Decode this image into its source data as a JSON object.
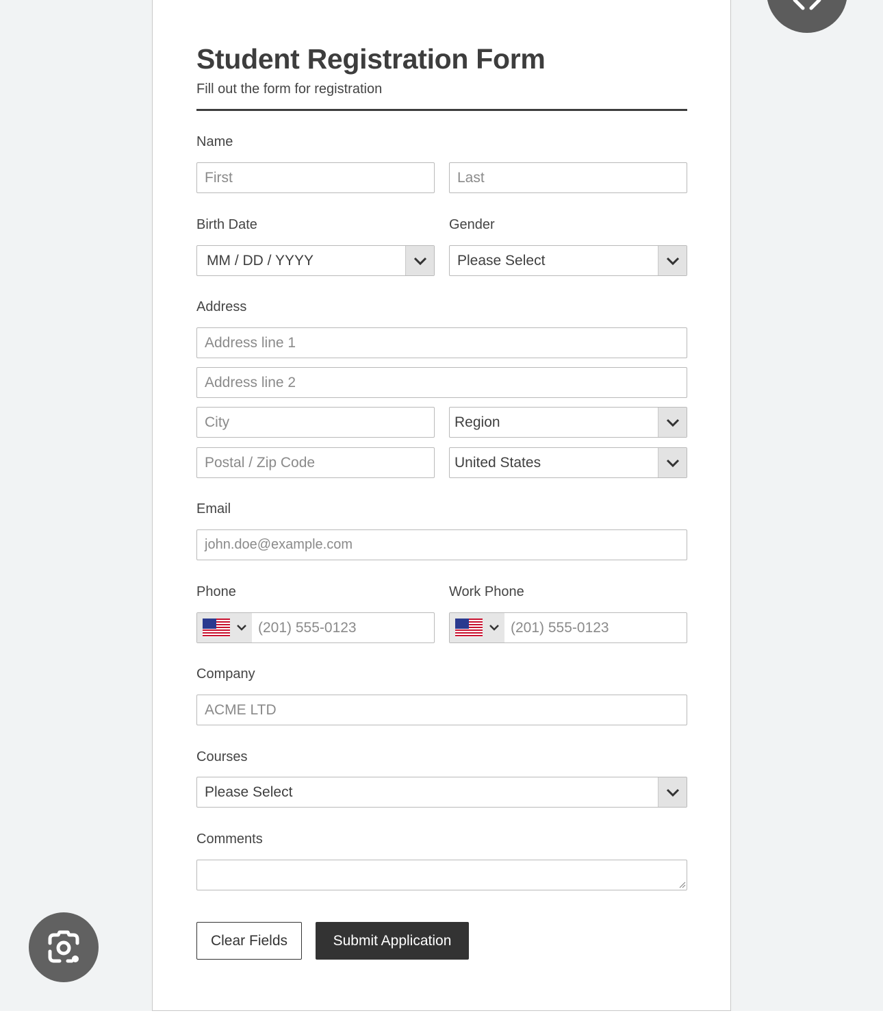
{
  "form": {
    "title": "Student Registration Form",
    "subtitle": "Fill out the form for registration",
    "name": {
      "label": "Name",
      "first_placeholder": "First",
      "last_placeholder": "Last"
    },
    "birth_date": {
      "label": "Birth Date",
      "placeholder": "MM / DD / YYYY"
    },
    "gender": {
      "label": "Gender",
      "value": "Please Select"
    },
    "address": {
      "label": "Address",
      "line1_placeholder": "Address line 1",
      "line2_placeholder": "Address line 2",
      "city_placeholder": "City",
      "region_value": "Region",
      "postal_placeholder": "Postal / Zip Code",
      "country_value": "United States"
    },
    "email": {
      "label": "Email",
      "placeholder": "john.doe@example.com"
    },
    "phone": {
      "label": "Phone",
      "placeholder": "(201) 555-0123",
      "country_flag": "us-flag-icon"
    },
    "work_phone": {
      "label": "Work Phone",
      "placeholder": "(201) 555-0123",
      "country_flag": "us-flag-icon"
    },
    "company": {
      "label": "Company",
      "placeholder": "ACME LTD"
    },
    "courses": {
      "label": "Courses",
      "value": "Please Select"
    },
    "comments": {
      "label": "Comments",
      "value": ""
    },
    "buttons": {
      "clear_label": "Clear Fields",
      "submit_label": "Submit Application"
    }
  },
  "overlay": {
    "close_icon": "close-icon",
    "lens_icon": "camera-search-icon"
  },
  "colors": {
    "accent": "#333333",
    "page_background": "#f1f3f4",
    "field_border": "#b9b9b9",
    "select_arrow_bg": "#e3e3e3"
  }
}
